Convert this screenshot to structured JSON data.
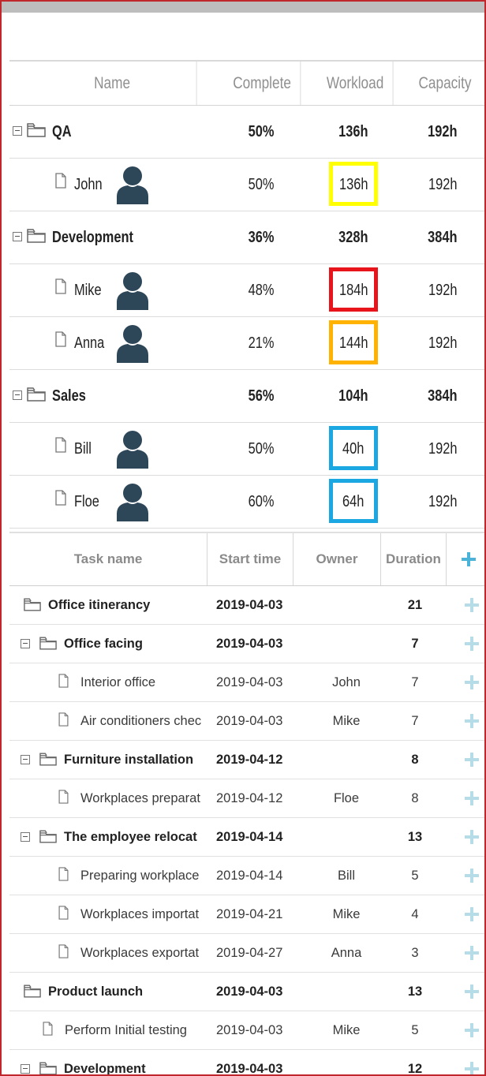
{
  "resource_panel": {
    "columns": [
      "Name",
      "Complete",
      "Workload",
      "Capacity"
    ],
    "rows": [
      {
        "type": "group",
        "name": "QA",
        "complete": "50%",
        "workload": "136h",
        "capacity": "192h"
      },
      {
        "type": "person",
        "name": "John",
        "complete": "50%",
        "workload": "136h",
        "capacity": "192h",
        "highlight": "#ffff00"
      },
      {
        "type": "group",
        "name": "Development",
        "complete": "36%",
        "workload": "328h",
        "capacity": "384h"
      },
      {
        "type": "person",
        "name": "Mike",
        "complete": "48%",
        "workload": "184h",
        "capacity": "192h",
        "highlight": "#e8141b"
      },
      {
        "type": "person",
        "name": "Anna",
        "complete": "21%",
        "workload": "144h",
        "capacity": "192h",
        "highlight": "#ffb300"
      },
      {
        "type": "group",
        "name": "Sales",
        "complete": "56%",
        "workload": "104h",
        "capacity": "384h"
      },
      {
        "type": "person",
        "name": "Bill",
        "complete": "50%",
        "workload": "40h",
        "capacity": "192h",
        "highlight": "#1aa7e2"
      },
      {
        "type": "person",
        "name": "Floe",
        "complete": "60%",
        "workload": "64h",
        "capacity": "192h",
        "highlight": "#1aa7e2"
      }
    ]
  },
  "task_grid": {
    "columns": {
      "task": "Task name",
      "start": "Start time",
      "owner": "Owner",
      "duration": "Duration"
    },
    "rows": [
      {
        "kind": "project",
        "level": 0,
        "expander": false,
        "name": "Office itinerancy",
        "start": "2019-04-03",
        "owner": "",
        "duration": "21"
      },
      {
        "kind": "project",
        "level": 1,
        "expander": true,
        "name": "Office facing",
        "start": "2019-04-03",
        "owner": "",
        "duration": "7"
      },
      {
        "kind": "task",
        "level": 2,
        "name": "Interior office",
        "start": "2019-04-03",
        "owner": "John",
        "duration": "7"
      },
      {
        "kind": "task",
        "level": 2,
        "name": "Air conditioners chec",
        "start": "2019-04-03",
        "owner": "Mike",
        "duration": "7"
      },
      {
        "kind": "project",
        "level": 1,
        "expander": true,
        "name": "Furniture installation",
        "start": "2019-04-12",
        "owner": "",
        "duration": "8"
      },
      {
        "kind": "task",
        "level": 2,
        "name": "Workplaces preparat",
        "start": "2019-04-12",
        "owner": "Floe",
        "duration": "8"
      },
      {
        "kind": "project",
        "level": 1,
        "expander": true,
        "name": "The employee relocat",
        "start": "2019-04-14",
        "owner": "",
        "duration": "13"
      },
      {
        "kind": "task",
        "level": 2,
        "name": "Preparing workplace",
        "start": "2019-04-14",
        "owner": "Bill",
        "duration": "5"
      },
      {
        "kind": "task",
        "level": 2,
        "name": "Workplaces importat",
        "start": "2019-04-21",
        "owner": "Mike",
        "duration": "4"
      },
      {
        "kind": "task",
        "level": 2,
        "name": "Workplaces exportat",
        "start": "2019-04-27",
        "owner": "Anna",
        "duration": "3"
      },
      {
        "kind": "project",
        "level": 0,
        "expander": false,
        "name": "Product launch",
        "start": "2019-04-03",
        "owner": "",
        "duration": "13"
      },
      {
        "kind": "task",
        "level": 1,
        "name": "Perform Initial testing",
        "start": "2019-04-03",
        "owner": "Mike",
        "duration": "5"
      },
      {
        "kind": "project",
        "level": 1,
        "expander": true,
        "name": "Development",
        "start": "2019-04-03",
        "owner": "",
        "duration": "12"
      }
    ]
  },
  "icons": {
    "expand": "collapse-box-icon",
    "folder": "folder-icon",
    "file": "file-icon",
    "person": "person-avatar-icon",
    "add": "add-task-icon"
  },
  "colors": {
    "frame": "#c0272d",
    "avatar": "#2d4759",
    "add_icon": "#b6dce8",
    "header_add_icon": "#4bb3d8"
  }
}
